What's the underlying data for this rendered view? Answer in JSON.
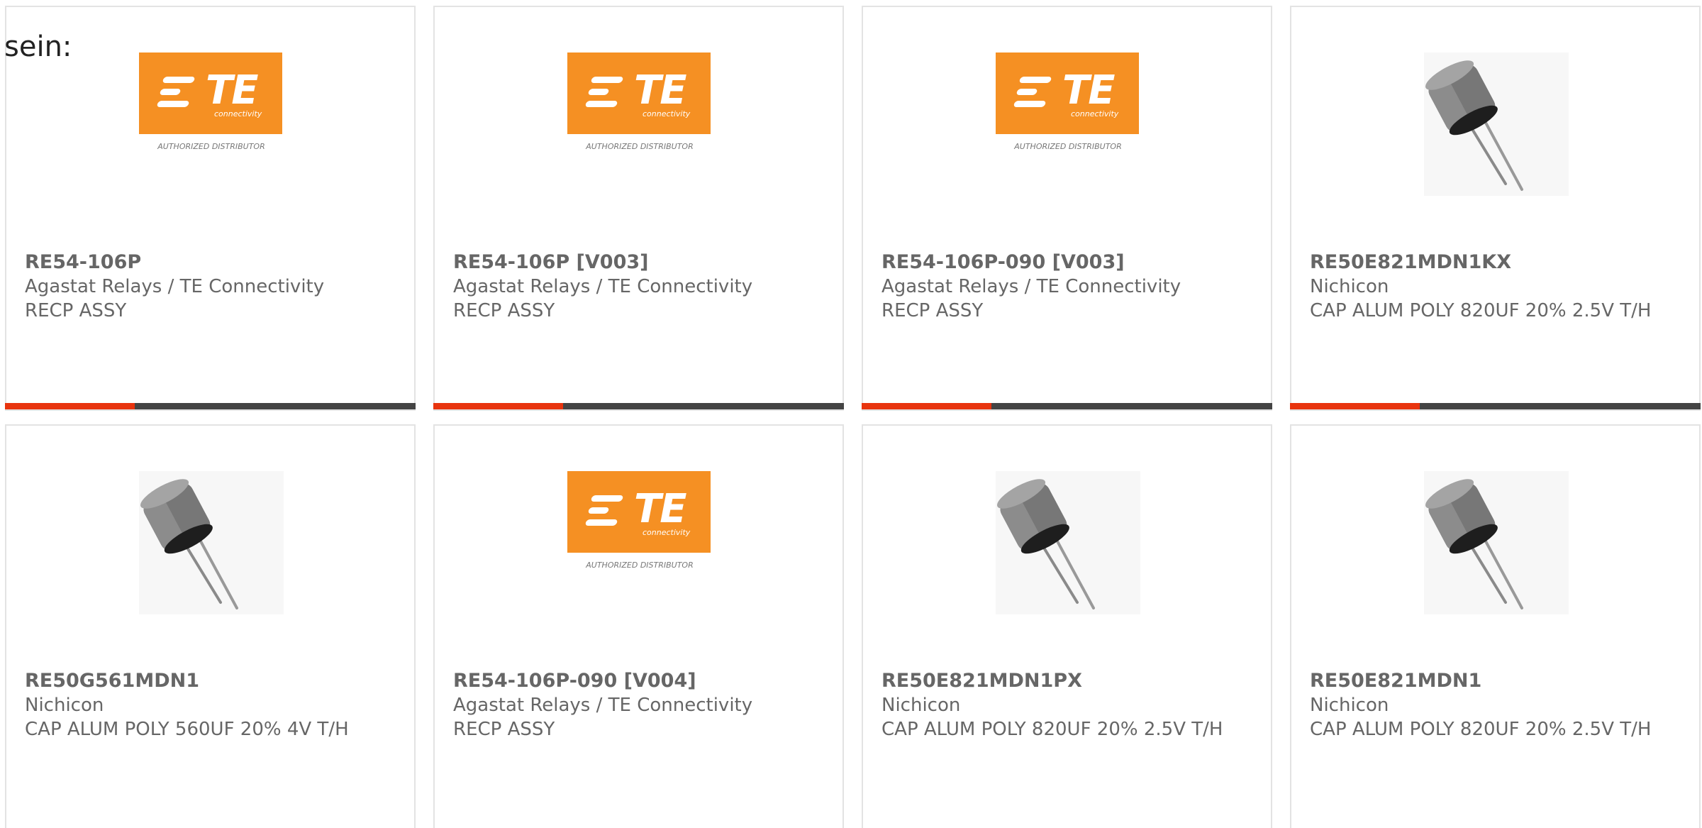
{
  "intro_text": "sein:",
  "products": [
    {
      "part_number": "RE54-106P",
      "manufacturer": "Agastat Relays / TE Connectivity",
      "description": "RECP ASSY",
      "image": "te-connectivity-logo"
    },
    {
      "part_number": "RE54-106P [V003]",
      "manufacturer": "Agastat Relays / TE Connectivity",
      "description": "RECP ASSY",
      "image": "te-connectivity-logo"
    },
    {
      "part_number": "RE54-106P-090 [V003]",
      "manufacturer": "Agastat Relays / TE Connectivity",
      "description": "RECP ASSY",
      "image": "te-connectivity-logo"
    },
    {
      "part_number": "RE50E821MDN1KX",
      "manufacturer": "Nichicon",
      "description": "CAP ALUM POLY 820UF 20% 2.5V T/H",
      "image": "capacitor-photo"
    },
    {
      "part_number": "RE50G561MDN1",
      "manufacturer": "Nichicon",
      "description": "CAP ALUM POLY 560UF 20% 4V T/H",
      "image": "capacitor-photo"
    },
    {
      "part_number": "RE54-106P-090 [V004]",
      "manufacturer": "Agastat Relays / TE Connectivity",
      "description": "RECP ASSY",
      "image": "te-connectivity-logo"
    },
    {
      "part_number": "RE50E821MDN1PX",
      "manufacturer": "Nichicon",
      "description": "CAP ALUM POLY 820UF 20% 2.5V T/H",
      "image": "capacitor-photo"
    },
    {
      "part_number": "RE50E821MDN1",
      "manufacturer": "Nichicon",
      "description": "CAP ALUM POLY 820UF 20% 2.5V T/H",
      "image": "capacitor-photo"
    }
  ],
  "te_logo": {
    "wordmark": "TE",
    "tagline": "connectivity",
    "caption": "AUTHORIZED DISTRIBUTOR"
  },
  "colors": {
    "te_orange": "#f59023",
    "bar_accent": "#e8340e",
    "bar_dark": "#444444",
    "text_gray": "#666666",
    "card_border": "#e3e3e3"
  }
}
